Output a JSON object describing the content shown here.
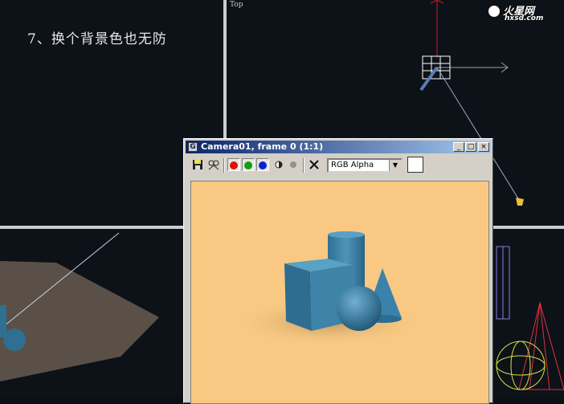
{
  "caption": "7、换个背景色也无防",
  "viewport": {
    "label": "Top"
  },
  "logo": {
    "brand": "火星网",
    "url": "hxsd.com"
  },
  "render_window": {
    "title": "Camera01, frame 0 (1:1)",
    "app_icon": "3ds-max-icon",
    "controls": {
      "minimize": "_",
      "maximize": "□",
      "close": "×"
    },
    "toolbar": {
      "save_icon": "floppy-disk-icon",
      "clone_icon": "clone-window-icon",
      "channels": [
        {
          "name": "red",
          "color": "#e01010"
        },
        {
          "name": "green",
          "color": "#10a010"
        },
        {
          "name": "blue",
          "color": "#1020d0"
        }
      ],
      "mono_icon": "half-circle-icon",
      "alpha_icon": "grey-dot-icon",
      "clear_icon": "x-icon",
      "channel_select": "RGB Alpha"
    },
    "background_color": "#f9c983"
  }
}
